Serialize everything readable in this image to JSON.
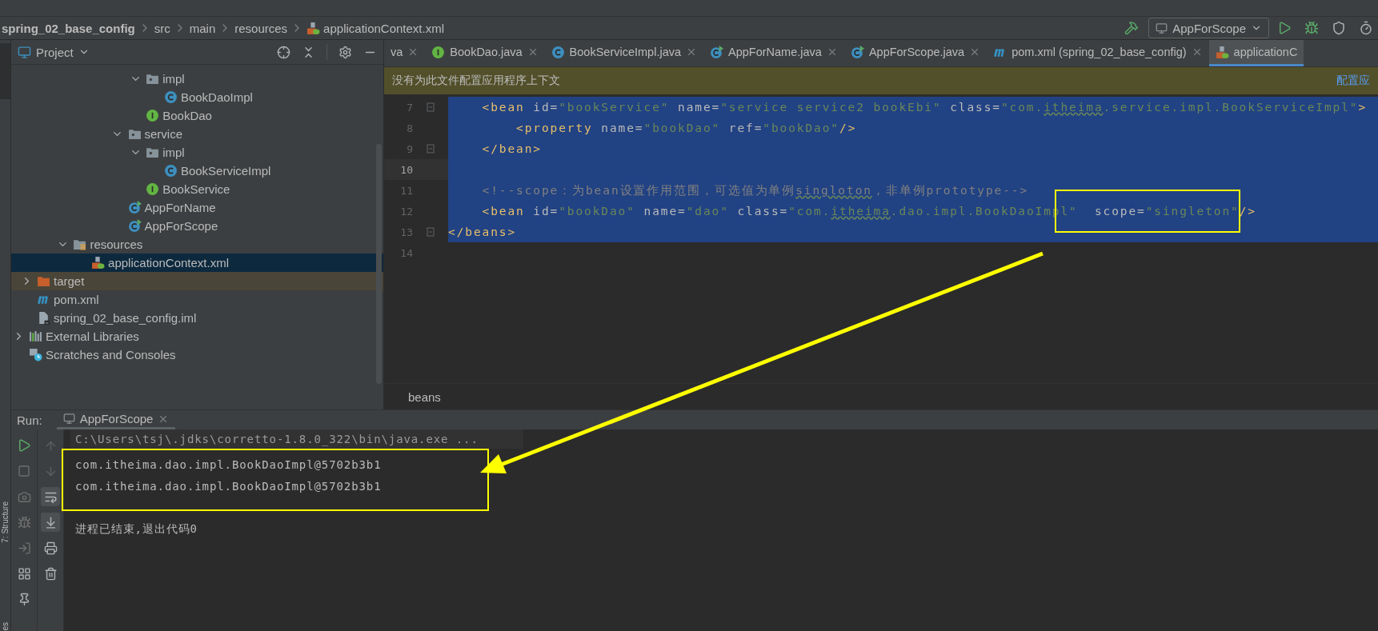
{
  "breadcrumb": [
    "spring_02_base_config",
    "src",
    "main",
    "resources",
    "applicationContext.xml"
  ],
  "run_config": "AppForScope",
  "project_panel": {
    "title": "Project",
    "tree": [
      {
        "children": [
          {
            "children": [
              {
                "children": [
                  {
                    "children": [
                      {
                        "children": [
                          {
                            "children": [
                              {
                                "children": [
                                  {
                                    "label": "impl",
                                    "kind": "package",
                                    "expanded": true,
                                    "selected": false,
                                    "hovered": false,
                                    "children": [
                                      {
                                        "label": "BookDaoImpl",
                                        "kind": "class",
                                        "selected": false,
                                        "hovered": false
                                      }
                                    ]
                                  },
                                  {
                                    "label": "BookDao",
                                    "kind": "interface",
                                    "selected": false,
                                    "hovered": false
                                  }
                                ]
                              },
                              {
                                "label": "service",
                                "kind": "package",
                                "expanded": true,
                                "selected": false,
                                "hovered": false,
                                "children": [
                                  {
                                    "label": "impl",
                                    "kind": "package",
                                    "expanded": true,
                                    "selected": false,
                                    "hovered": false,
                                    "children": [
                                      {
                                        "label": "BookServiceImpl",
                                        "kind": "class",
                                        "selected": false,
                                        "hovered": false
                                      }
                                    ]
                                  },
                                  {
                                    "label": "BookService",
                                    "kind": "interface",
                                    "selected": false,
                                    "hovered": false
                                  }
                                ]
                              },
                              {
                                "label": "AppForName",
                                "kind": "runnable",
                                "selected": false,
                                "hovered": false
                              },
                              {
                                "label": "AppForScope",
                                "kind": "runnable",
                                "selected": false,
                                "hovered": false
                              }
                            ]
                          }
                        ]
                      }
                    ]
                  },
                  {
                    "label": "resources",
                    "kind": "resources",
                    "expanded": true,
                    "selected": false,
                    "hovered": false,
                    "children": [
                      {
                        "label": "applicationContext.xml",
                        "kind": "spring-xml",
                        "selected": true,
                        "hovered": false
                      }
                    ]
                  }
                ]
              }
            ]
          },
          {
            "label": "target",
            "kind": "excluded",
            "expanded": false,
            "selected": false,
            "hovered": true
          },
          {
            "label": "pom.xml",
            "kind": "maven",
            "selected": false,
            "hovered": false
          },
          {
            "label": "spring_02_base_config.iml",
            "kind": "iml",
            "selected": false,
            "hovered": false
          }
        ]
      },
      {
        "label": "External Libraries",
        "kind": "libraries",
        "expanded": false,
        "selected": false,
        "hovered": false
      },
      {
        "label": "Scratches and Consoles",
        "kind": "scratches",
        "selected": false,
        "hovered": false
      }
    ]
  },
  "editor_tabs": [
    {
      "label": "va",
      "kind": "none",
      "selected": false
    },
    {
      "label": "BookDao.java",
      "kind": "interface",
      "selected": false
    },
    {
      "label": "BookServiceImpl.java",
      "kind": "class",
      "selected": false
    },
    {
      "label": "AppForName.java",
      "kind": "runnable",
      "selected": false
    },
    {
      "label": "AppForScope.java",
      "kind": "runnable",
      "selected": false
    },
    {
      "label": "pom.xml (spring_02_base_config)",
      "kind": "maven",
      "selected": false
    },
    {
      "label": "applicationC",
      "kind": "spring-xml",
      "selected": true
    }
  ],
  "banner": {
    "message": "没有为此文件配置应用程序上下文",
    "link": "配置应"
  },
  "code_lines": [
    {
      "number": "7",
      "selected": true,
      "current": false,
      "fold": true,
      "segments": [
        {
          "kind": "tag",
          "text": "    <bean"
        },
        {
          "kind": "attr",
          "text": " id="
        },
        {
          "kind": "str",
          "text": "\"bookService\""
        },
        {
          "kind": "attr",
          "text": " name="
        },
        {
          "kind": "str",
          "text": "\"service service2 bookEbi\""
        },
        {
          "kind": "attr",
          "text": " class="
        },
        {
          "kind": "str",
          "text": "\"com."
        },
        {
          "kind": "typo",
          "text": "itheima"
        },
        {
          "kind": "str",
          "text": ".service.impl.BookServiceImpl\""
        },
        {
          "kind": "tag",
          "text": ">"
        }
      ]
    },
    {
      "number": "8",
      "selected": true,
      "current": false,
      "fold": false,
      "segments": [
        {
          "kind": "tag",
          "text": "        <property"
        },
        {
          "kind": "attr",
          "text": " name="
        },
        {
          "kind": "str",
          "text": "\"bookDao\""
        },
        {
          "kind": "attr",
          "text": " ref="
        },
        {
          "kind": "str",
          "text": "\"bookDao\""
        },
        {
          "kind": "tag",
          "text": "/>"
        }
      ]
    },
    {
      "number": "9",
      "selected": true,
      "current": false,
      "fold": true,
      "segments": [
        {
          "kind": "tag",
          "text": "    </bean>"
        }
      ]
    },
    {
      "number": "10",
      "selected": true,
      "current": true,
      "fold": false
    },
    {
      "number": "11",
      "selected": true,
      "current": false,
      "fold": false,
      "segments": [
        {
          "kind": "comment",
          "text": "    <!--scope：为bean设置作用范围，可选值为单例"
        },
        {
          "kind": "comment-typo",
          "text": "singloton"
        },
        {
          "kind": "comment",
          "text": "，非单例prototype-->"
        }
      ]
    },
    {
      "number": "12",
      "selected": true,
      "current": false,
      "fold": false,
      "segments": [
        {
          "kind": "tag",
          "text": "    <bean"
        },
        {
          "kind": "attr",
          "text": " id="
        },
        {
          "kind": "str",
          "text": "\"bookDao\""
        },
        {
          "kind": "attr",
          "text": " name="
        },
        {
          "kind": "str",
          "text": "\"dao\""
        },
        {
          "kind": "attr",
          "text": " class="
        },
        {
          "kind": "str",
          "text": "\"com."
        },
        {
          "kind": "typo",
          "text": "itheima"
        },
        {
          "kind": "str",
          "text": ".dao.impl.BookDaoImpl\""
        },
        {
          "kind": "attr",
          "text": "  scope="
        },
        {
          "kind": "str",
          "text": "\"singleton\""
        },
        {
          "kind": "tag",
          "text": "/>"
        }
      ]
    },
    {
      "number": "13",
      "selected": true,
      "current": false,
      "fold": true,
      "segments": [
        {
          "kind": "tag",
          "text": "</beans>"
        }
      ]
    },
    {
      "number": "14",
      "selected": false,
      "current": false,
      "fold": false
    }
  ],
  "editor_breadcrumb": "beans",
  "run_panel": {
    "label": "Run:",
    "tab": "AppForScope",
    "soft_wrap_on": true,
    "scroll_to_end_on": true,
    "console": [
      {
        "kind": "command",
        "text": "C:\\Users\\tsj\\.jdks\\corretto-1.8.0_322\\bin\\java.exe ..."
      },
      {
        "kind": "output",
        "text": "com.itheima.dao.impl.BookDaoImpl@5702b3b1"
      },
      {
        "kind": "output",
        "text": "com.itheima.dao.impl.BookDaoImpl@5702b3b1"
      },
      {
        "kind": "exit",
        "text": "进程已结束,退出代码0"
      }
    ]
  },
  "side_stripe": [
    "7: Structure",
    "es"
  ]
}
